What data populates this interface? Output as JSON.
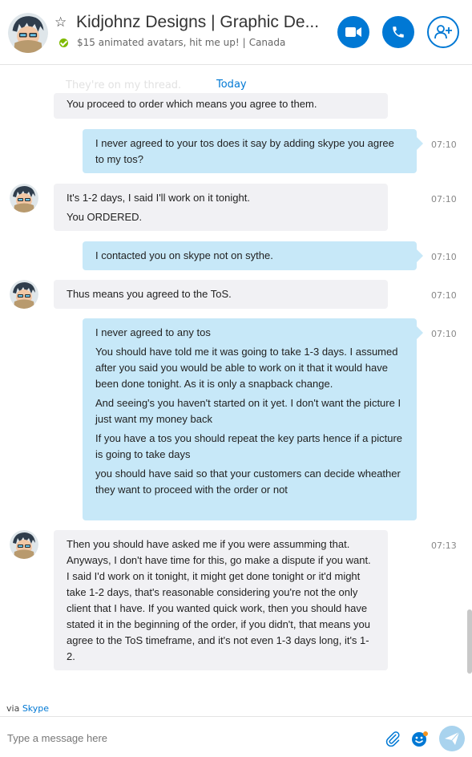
{
  "header": {
    "title": "Kidjohnz Designs | Graphic De...",
    "mood": "$15 animated avatars, hit me up!",
    "location": "Canada",
    "accent": "#0078d4",
    "status_color": "#7fba00"
  },
  "chat": {
    "date_divider": "Today",
    "ghost_lines": [
      "They're on my thread."
    ]
  },
  "messages": [
    {
      "dir": "in",
      "time": "",
      "lines": [
        "You proceed to order which means you agree to them."
      ]
    },
    {
      "dir": "out",
      "time": "07:10",
      "lines": [
        "I never agreed to your tos does it say by adding skype you agree to my tos?"
      ]
    },
    {
      "dir": "in",
      "time": "07:10",
      "lines": [
        "It's 1-2 days, I said I'll work on it tonight.",
        "You ORDERED."
      ]
    },
    {
      "dir": "out",
      "time": "07:10",
      "lines": [
        "I contacted you on skype not on sythe."
      ]
    },
    {
      "dir": "in",
      "time": "07:10",
      "lines": [
        "Thus means you agreed to the ToS."
      ]
    },
    {
      "dir": "out",
      "time": "07:10",
      "lines": [
        "I never agreed to any tos",
        "You should have told me it was going to take 1-3 days. I assumed after you said you would be able to work on it that it would have been done tonight. As it is only a snapback change.",
        "And seeing's you haven't started on it yet. I don't want the picture I just want my money back",
        "If you have a tos you should repeat the key parts hence if a picture is going to take days",
        "you should have said so that your customers can decide wheather they want to proceed with the order or not"
      ]
    },
    {
      "dir": "in",
      "time": "07:13",
      "lines": [
        "Then you should have asked me if you were assumming that. Anyways, I don't have time for this, go make a dispute if you want. I said I'd work on it tonight, it might get done tonight or it'd might take 1-2 days, that's reasonable considering you're not the only client that I have. If you wanted quick work, then you should have stated it in the beginning of the order, if you didn't, that means you agree to the ToS timeframe, and it's not even 1-3 days long, it's 1-2."
      ]
    }
  ],
  "footer": {
    "via_prefix": "via",
    "via_link": "Skype",
    "composer_placeholder": "Type a message here"
  },
  "icons": {
    "favorite": "star-icon",
    "video": "video-call-icon",
    "call": "phone-icon",
    "add_people": "add-person-icon",
    "attach": "paperclip-icon",
    "emoji": "emoticon-icon",
    "send": "send-icon"
  }
}
